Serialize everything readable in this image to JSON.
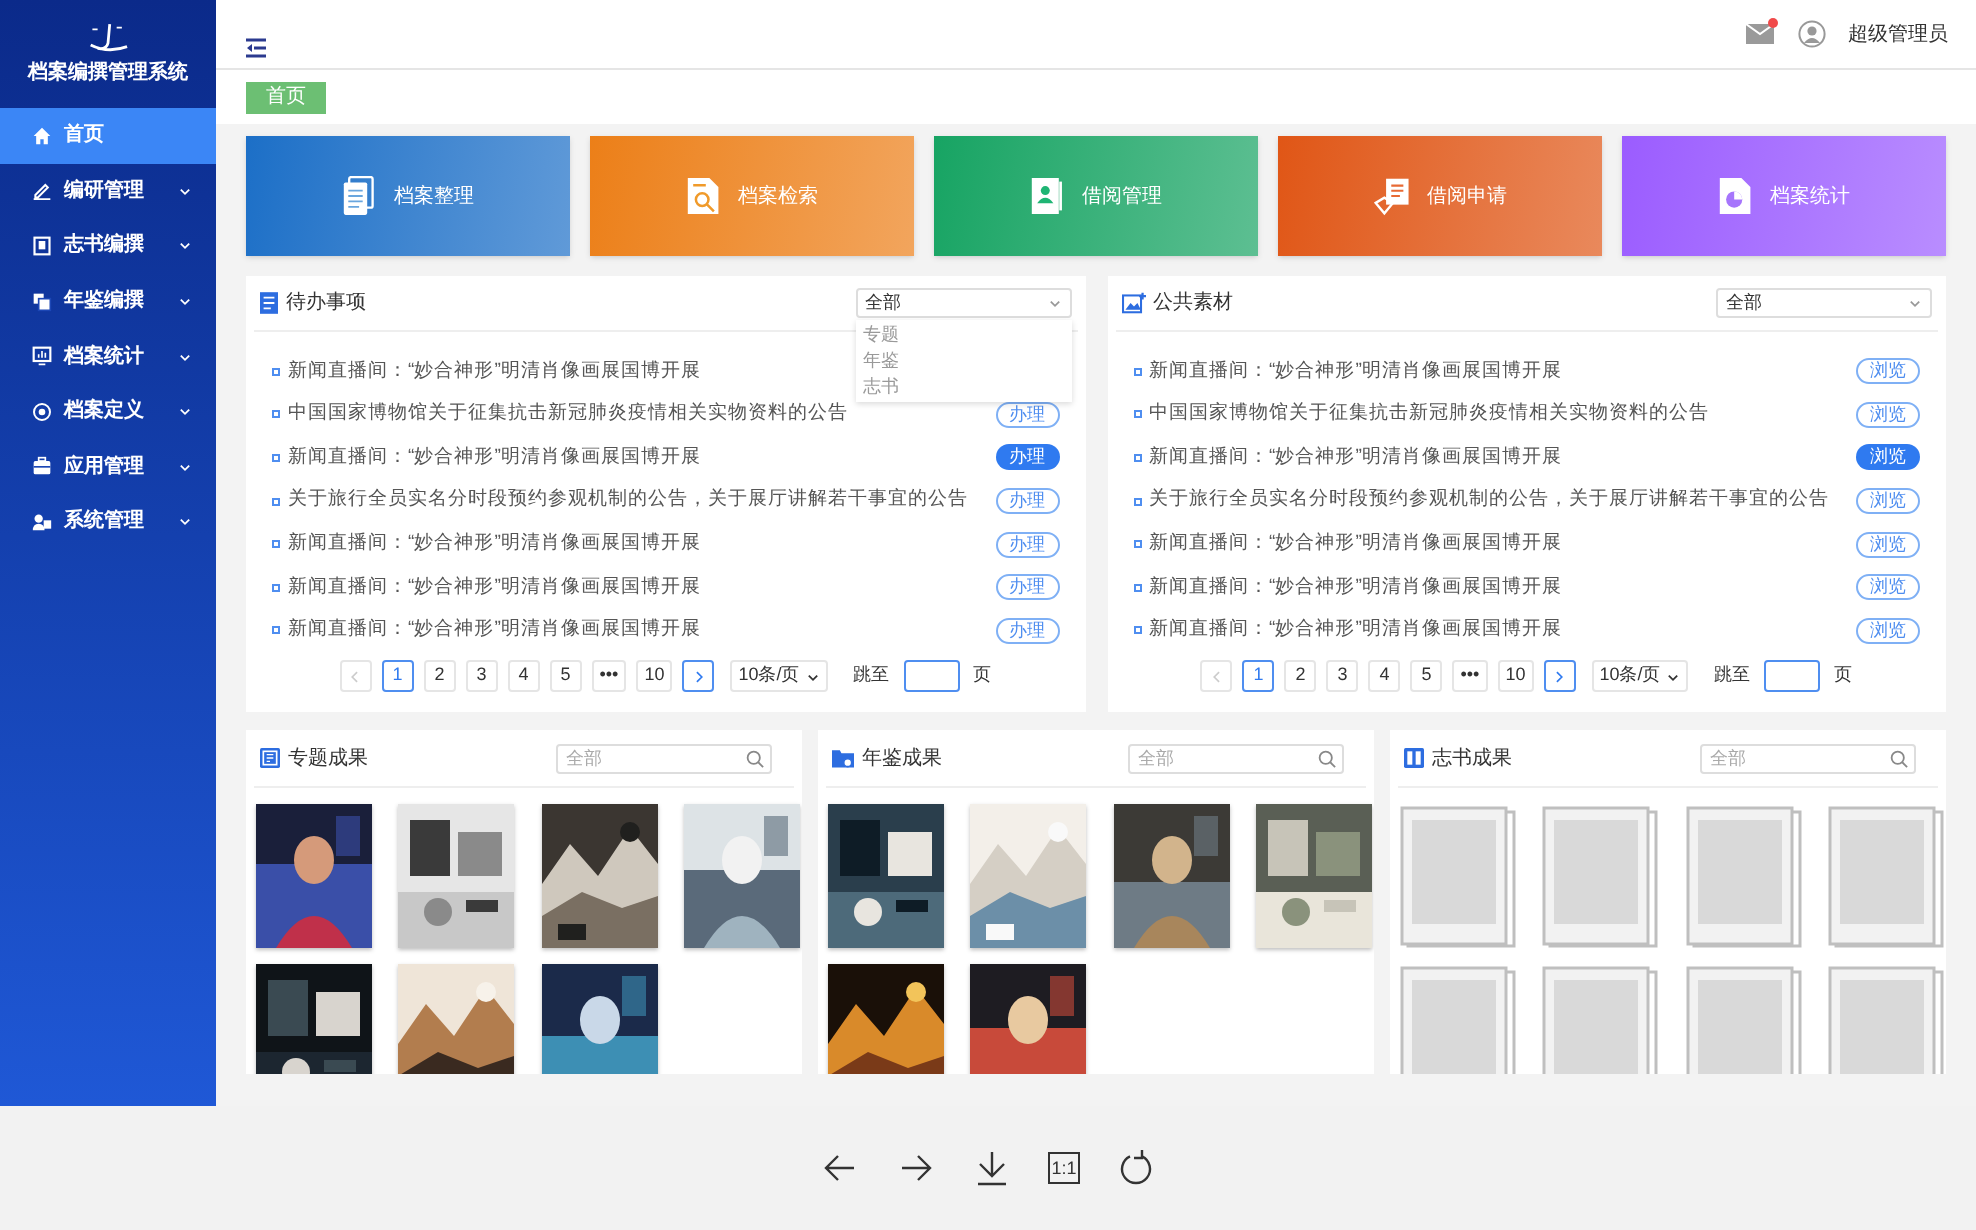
{
  "sidebar": {
    "logo_text": "档案编撰管理系统",
    "items": [
      {
        "label": "首页",
        "selected": true,
        "expandable": false
      },
      {
        "label": "编研管理",
        "selected": false,
        "expandable": true
      },
      {
        "label": "志书编撰",
        "selected": false,
        "expandable": true
      },
      {
        "label": "年鉴编撰",
        "selected": false,
        "expandable": true
      },
      {
        "label": "档案统计",
        "selected": false,
        "expandable": true
      },
      {
        "label": "档案定义",
        "selected": false,
        "expandable": true
      },
      {
        "label": "应用管理",
        "selected": false,
        "expandable": true
      },
      {
        "label": "系统管理",
        "selected": false,
        "expandable": true
      }
    ]
  },
  "header": {
    "mail_unread": true,
    "user": "超级管理员"
  },
  "breadcrumb": [
    {
      "label": "首页",
      "selected": true
    }
  ],
  "tiles": [
    {
      "label": "档案整理",
      "color": "#1c6fc7"
    },
    {
      "label": "档案检索",
      "color": "#ec7f18"
    },
    {
      "label": "借阅管理",
      "color": "#17a463"
    },
    {
      "label": "借阅申请",
      "color": "#e05616"
    },
    {
      "label": "档案统计",
      "color": "#9b5cff"
    }
  ],
  "panels": [
    {
      "title": "待办事项",
      "filter": {
        "value": "全部",
        "options": [
          "专题",
          "年鉴",
          "志书"
        ]
      },
      "items": [
        {
          "text": "新闻直播间：“妙合神形”明清肖像画展国博开展",
          "selected": false
        },
        {
          "text": "中国国家博物馆关于征集抗击新冠肺炎疫情相关实物资料的公告",
          "action": "办理",
          "selected": false
        },
        {
          "text": "新闻直播间：“妙合神形”明清肖像画展国博开展",
          "action": "办理",
          "selected": true
        },
        {
          "text": "关于旅行全员实名分时段预约参观机制的公告，关于展厅讲解若干事宜的公告",
          "action": "办理",
          "selected": false
        },
        {
          "text": "新闻直播间：“妙合神形”明清肖像画展国博开展",
          "action": "办理",
          "selected": false
        },
        {
          "text": "新闻直播间：“妙合神形”明清肖像画展国博开展",
          "action": "办理",
          "selected": false
        },
        {
          "text": "新闻直播间：“妙合神形”明清肖像画展国博开展",
          "action": "办理",
          "selected": false
        }
      ],
      "pagination": {
        "pages": [
          {
            "label": "1",
            "selected": true
          },
          {
            "label": "2",
            "selected": false
          },
          {
            "label": "3",
            "selected": false
          },
          {
            "label": "4",
            "selected": false
          },
          {
            "label": "5",
            "selected": false
          },
          {
            "label": "•••",
            "selected": false
          },
          {
            "label": "10",
            "selected": false
          }
        ],
        "page_size": "10条/页",
        "jump_label": "跳至",
        "jump_suffix": "页"
      }
    },
    {
      "title": "公共素材",
      "filter": {
        "value": "全部"
      },
      "items": [
        {
          "text": "新闻直播间：“妙合神形”明清肖像画展国博开展",
          "action": "浏览",
          "selected": false
        },
        {
          "text": "中国国家博物馆关于征集抗击新冠肺炎疫情相关实物资料的公告",
          "action": "浏览",
          "selected": false
        },
        {
          "text": "新闻直播间：“妙合神形”明清肖像画展国博开展",
          "action": "浏览",
          "selected": true
        },
        {
          "text": "关于旅行全员实名分时段预约参观机制的公告，关于展厅讲解若干事宜的公告",
          "action": "浏览",
          "selected": false
        },
        {
          "text": "新闻直播间：“妙合神形”明清肖像画展国博开展",
          "action": "浏览",
          "selected": false
        },
        {
          "text": "新闻直播间：“妙合神形”明清肖像画展国博开展",
          "action": "浏览",
          "selected": false
        },
        {
          "text": "新闻直播间：“妙合神形”明清肖像画展国博开展",
          "action": "浏览",
          "selected": false
        }
      ],
      "pagination": {
        "pages": [
          {
            "label": "1",
            "selected": true
          },
          {
            "label": "2",
            "selected": false
          },
          {
            "label": "3",
            "selected": false
          },
          {
            "label": "4",
            "selected": false
          },
          {
            "label": "5",
            "selected": false
          },
          {
            "label": "•••",
            "selected": false
          },
          {
            "label": "10",
            "selected": false
          }
        ],
        "page_size": "10条/页",
        "jump_label": "跳至",
        "jump_suffix": "页"
      }
    }
  ],
  "galleries": [
    {
      "title": "专题成果",
      "search_placeholder": "全部"
    },
    {
      "title": "年鉴成果",
      "search_placeholder": "全部"
    },
    {
      "title": "志书成果",
      "search_placeholder": "全部",
      "items": [
        {
          "kind": "placeholder"
        },
        {
          "kind": "placeholder"
        },
        {
          "kind": "placeholder"
        },
        {
          "kind": "placeholder"
        },
        {
          "kind": "placeholder"
        },
        {
          "kind": "placeholder"
        },
        {
          "kind": "placeholder"
        },
        {
          "kind": "placeholder"
        }
      ]
    }
  ],
  "viewer_toolbar": {
    "actual_size_label": "1:1"
  }
}
